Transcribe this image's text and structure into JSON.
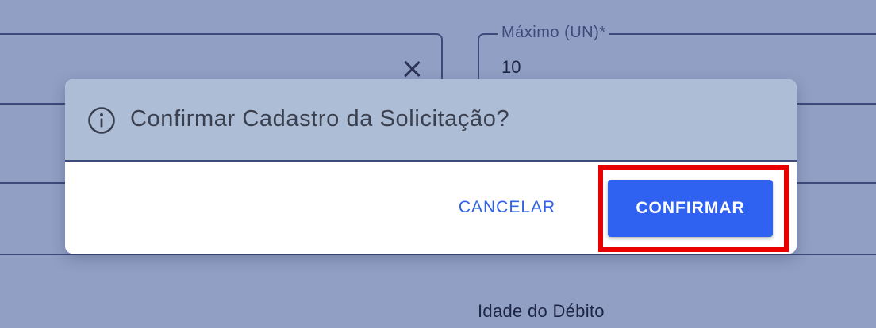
{
  "background_form": {
    "max_field_label": "Máximo (UN)*",
    "max_field_value": "10",
    "caption": "Idade do Débito"
  },
  "dialog": {
    "icon": "info-icon",
    "title": "Confirmar Cadastro da Solicitação?",
    "cancel_label": "CANCELAR",
    "confirm_label": "CONFIRMAR"
  },
  "colors": {
    "overlay": "#919fc4",
    "dialog_header": "#adbdd5",
    "primary": "#2f62f0",
    "highlight": "#e80000"
  }
}
